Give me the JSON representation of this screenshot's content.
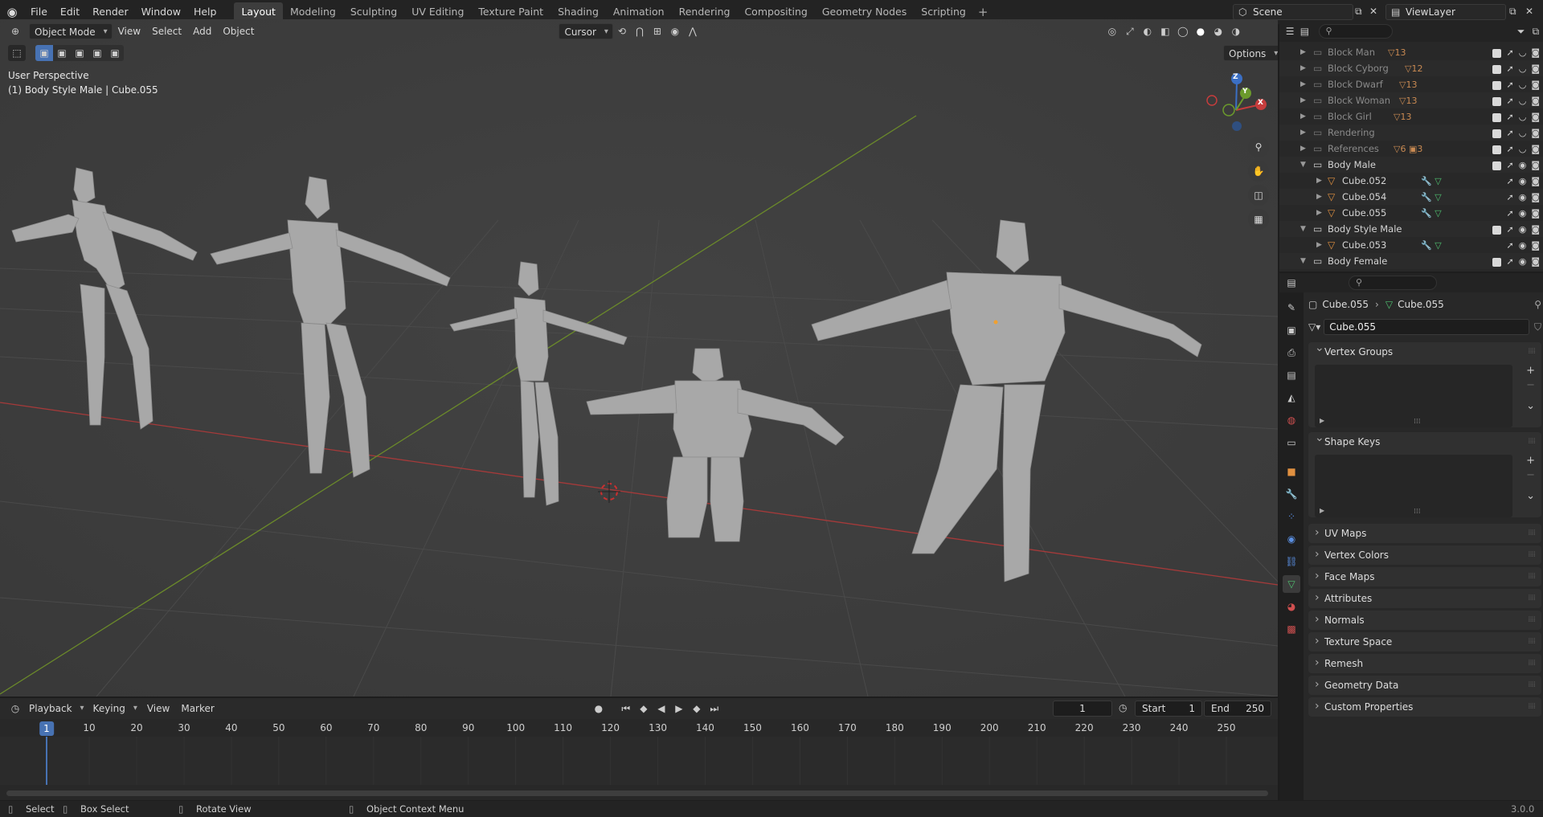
{
  "menu": [
    "File",
    "Edit",
    "Render",
    "Window",
    "Help"
  ],
  "workspaces": [
    "Layout",
    "Modeling",
    "Sculpting",
    "UV Editing",
    "Texture Paint",
    "Shading",
    "Animation",
    "Rendering",
    "Compositing",
    "Geometry Nodes",
    "Scripting"
  ],
  "active_workspace": "Layout",
  "scene": "Scene",
  "view_layer": "ViewLayer",
  "viewport_header": {
    "mode": "Object Mode",
    "menus": [
      "View",
      "Select",
      "Add",
      "Object"
    ],
    "pivot": "Cursor",
    "options": "Options"
  },
  "viewport": {
    "perspective": "User Perspective",
    "active": "(1) Body Style Male | Cube.055",
    "gizmo": {
      "z": "Z",
      "y": "Y",
      "x": "X"
    }
  },
  "outliner": [
    {
      "label": "Block Man",
      "count": "13",
      "dim": true
    },
    {
      "label": "Block Cyborg",
      "count": "12",
      "dim": true
    },
    {
      "label": "Block Dwarf",
      "count": "13",
      "dim": true
    },
    {
      "label": "Block Woman",
      "count": "13",
      "dim": true
    },
    {
      "label": "Block Girl",
      "count": "13",
      "dim": true
    },
    {
      "label": "Rendering",
      "count": "",
      "dim": true
    },
    {
      "label": "References",
      "count": "6",
      "count2": "3",
      "dim": true
    },
    {
      "label": "Body Male",
      "count": "",
      "dim": false
    },
    {
      "label": "Cube.052",
      "count": "",
      "dim": false
    },
    {
      "label": "Cube.054",
      "count": "",
      "dim": false
    },
    {
      "label": "Cube.055",
      "count": "",
      "dim": false
    },
    {
      "label": "Body Style Male",
      "count": "",
      "dim": false
    },
    {
      "label": "Cube.053",
      "count": "",
      "dim": false
    },
    {
      "label": "Body Female",
      "count": "",
      "dim": false
    }
  ],
  "properties": {
    "breadcrumb_object": "Cube.055",
    "breadcrumb_data": "Cube.055",
    "mesh_name": "Cube.055",
    "open_panels": [
      "Vertex Groups",
      "Shape Keys"
    ],
    "closed_panels": [
      "UV Maps",
      "Vertex Colors",
      "Face Maps",
      "Attributes",
      "Normals",
      "Texture Space",
      "Remesh",
      "Geometry Data",
      "Custom Properties"
    ]
  },
  "timeline": {
    "menus": [
      "Playback",
      "Keying",
      "View",
      "Marker"
    ],
    "current_frame": "1",
    "start_label": "Start",
    "start": "1",
    "end_label": "End",
    "end": "250",
    "ticks": [
      "10",
      "20",
      "30",
      "40",
      "50",
      "60",
      "70",
      "80",
      "90",
      "100",
      "110",
      "120",
      "130",
      "140",
      "150",
      "160",
      "170",
      "180",
      "190",
      "200",
      "210",
      "220",
      "230",
      "240",
      "250"
    ],
    "cursor_label": "1"
  },
  "statusbar": {
    "select": "Select",
    "box_select": "Box Select",
    "rotate": "Rotate View",
    "context": "Object Context Menu",
    "version": "3.0.0"
  }
}
